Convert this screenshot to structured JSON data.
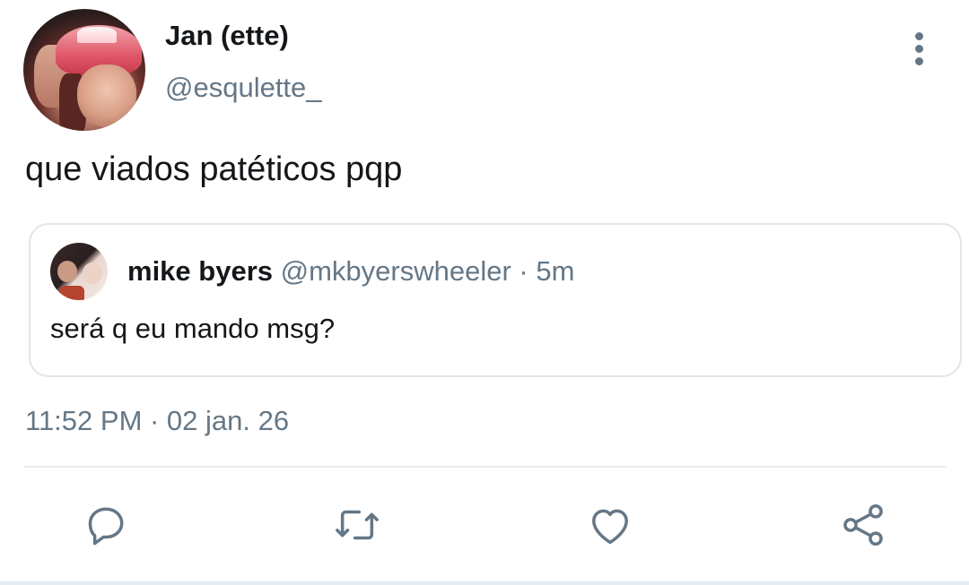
{
  "author": {
    "display_name": "Jan (ette)",
    "handle": "@esqulette_"
  },
  "tweet": {
    "text": "que viados patéticos pqp",
    "timestamp": "11:52 PM · 02 jan. 26"
  },
  "quoted_tweet": {
    "display_name": "mike byers",
    "handle": "@mkbyerswheeler",
    "separator": "·",
    "age": "5m",
    "text": "será q eu mando msg?"
  },
  "actions": {
    "reply": "reply-icon",
    "retweet": "retweet-icon",
    "like": "heart-icon",
    "share": "share-icon"
  },
  "colors": {
    "text_primary": "#14171a",
    "text_secondary": "#657786",
    "border": "#dfe6ea",
    "divider": "#e6ecf0"
  }
}
